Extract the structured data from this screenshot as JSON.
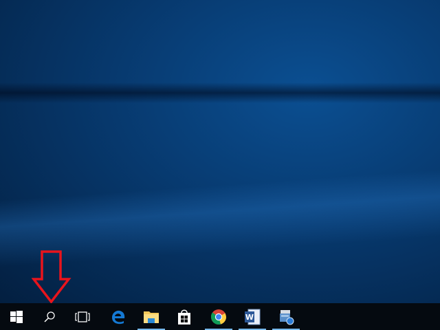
{
  "taskbar": {
    "items": [
      {
        "name": "start",
        "icon": "windows-logo-icon"
      },
      {
        "name": "search",
        "icon": "search-icon"
      },
      {
        "name": "task-view",
        "icon": "task-view-icon"
      },
      {
        "name": "edge",
        "icon": "edge-icon",
        "running": false
      },
      {
        "name": "file-explorer",
        "icon": "folder-icon",
        "running": true
      },
      {
        "name": "store",
        "icon": "store-bag-icon",
        "running": false
      },
      {
        "name": "chrome",
        "icon": "chrome-icon",
        "running": true
      },
      {
        "name": "word",
        "icon": "word-icon",
        "running": true
      },
      {
        "name": "network-app",
        "icon": "network-app-icon",
        "running": true
      }
    ]
  },
  "annotation": {
    "icon": "red-down-arrow",
    "color": "#e8141c"
  },
  "colors": {
    "taskbar": "#050a10",
    "running_indicator": "#76b9ed",
    "accent": "#0b4f92"
  }
}
